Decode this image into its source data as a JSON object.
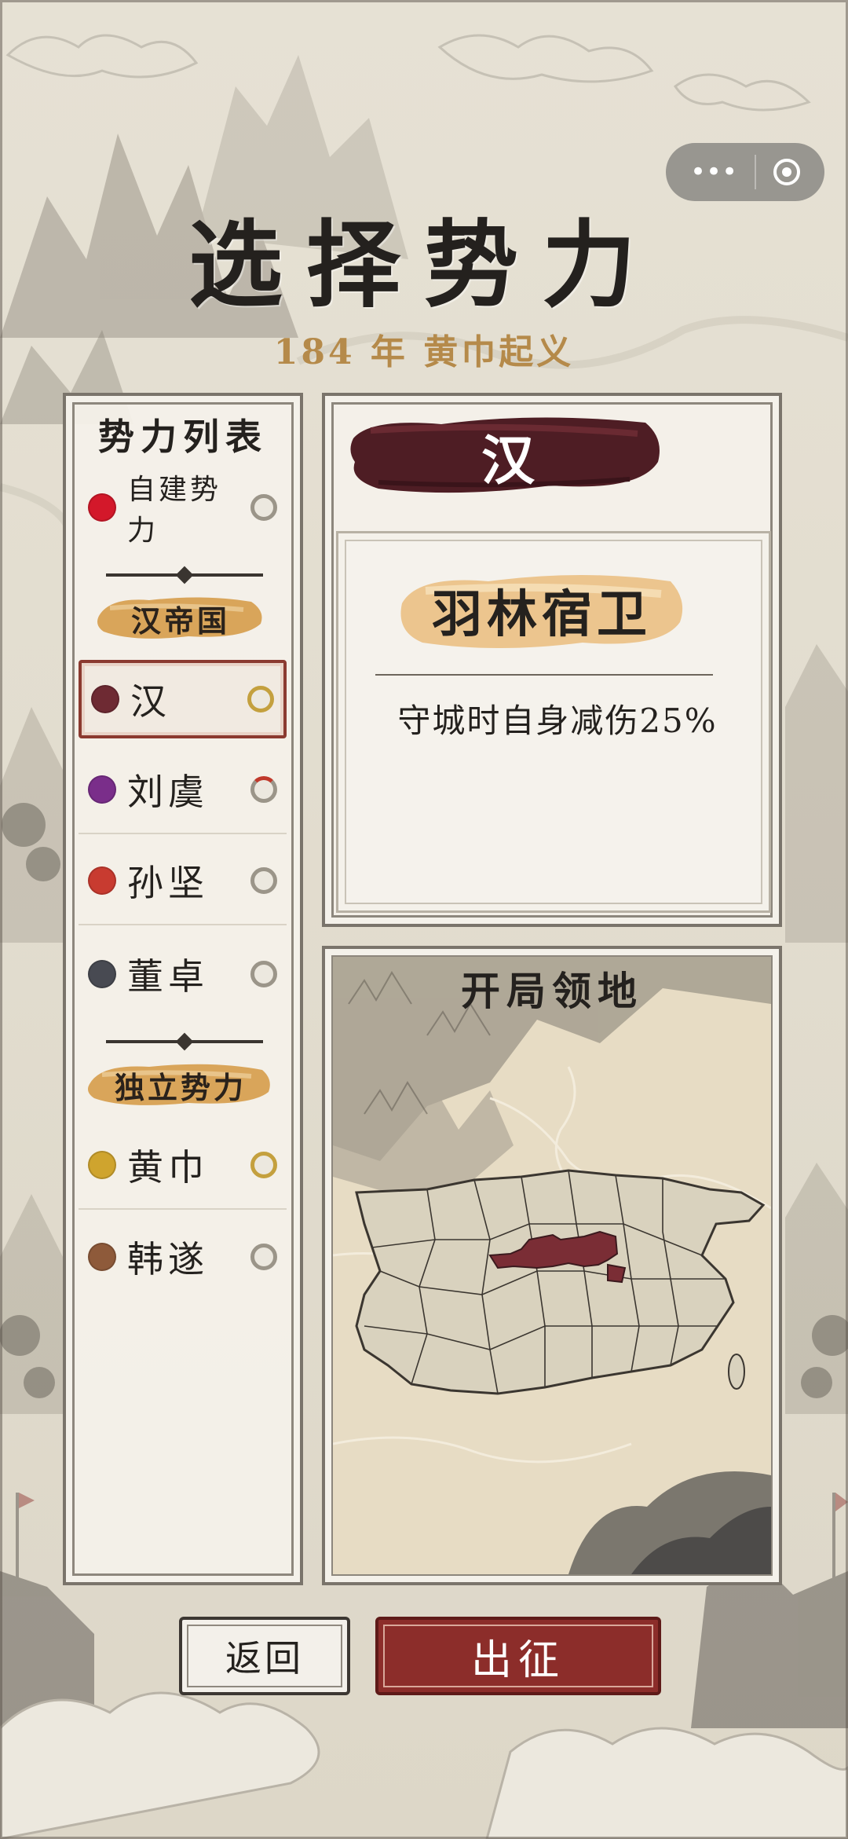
{
  "header": {
    "title": "选择势力",
    "subtitle": "184 年  黄巾起义"
  },
  "capsule": {
    "more_icon": "more-dots-icon",
    "close_icon": "record-circle-icon"
  },
  "faction_list": {
    "title": "势力列表",
    "custom": {
      "label": "自建势力",
      "color": "#d3182a"
    },
    "groups": [
      {
        "label": "汉帝国",
        "items": [
          {
            "label": "汉",
            "color": "#6e2a33",
            "selected": true
          },
          {
            "label": "刘虞",
            "color": "#7a2e8a"
          },
          {
            "label": "孙坚",
            "color": "#c83b30"
          },
          {
            "label": "董卓",
            "color": "#484a52"
          }
        ]
      },
      {
        "label": "独立势力",
        "items": [
          {
            "label": "黄巾",
            "color": "#cfa42e"
          },
          {
            "label": "韩遂",
            "color": "#8e5a3a"
          }
        ]
      }
    ]
  },
  "detail": {
    "faction_name": "汉",
    "trait_name": "羽林宿卫",
    "trait_desc": "守城时自身减伤25%"
  },
  "map": {
    "title": "开局领地",
    "highlight_color": "#7a2d35"
  },
  "actions": {
    "back_label": "返回",
    "go_label": "出征"
  },
  "colors": {
    "accent_red": "#8c2d2a",
    "gold_text": "#b58a4a",
    "ink": "#24211e"
  }
}
